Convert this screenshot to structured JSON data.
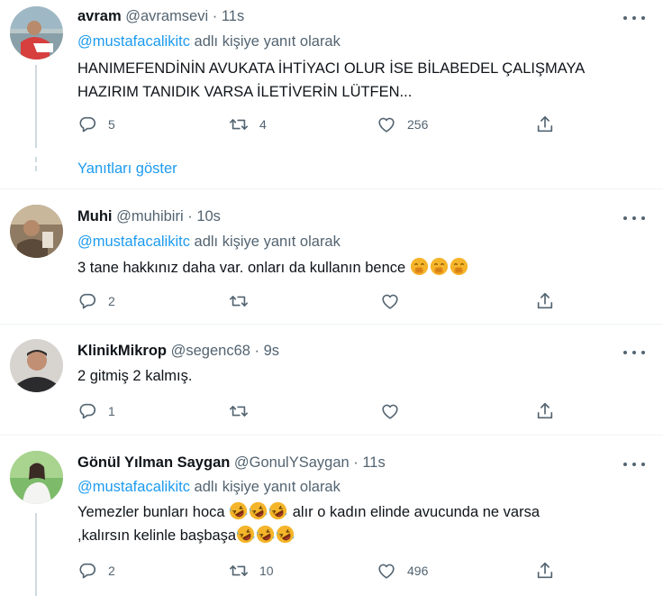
{
  "tweets": [
    {
      "name": "avram",
      "handle": "@avramsevi",
      "time": "11s",
      "reply_prefix": "",
      "mention": "@mustafacalikitc",
      "reply_suffix": " adlı kişiye yanıt olarak",
      "text_line1": "HANIMEFENDİNİN AVUKATA İHTİYACI OLUR İSE BİLABEDEL ÇALIŞMAYA",
      "text_line2": "HAZIRIM TANIDIK VARSA İLETİVERİN LÜTFEN...",
      "replies": "5",
      "retweets": "4",
      "likes": "256"
    },
    {
      "name": "Muhi",
      "handle": "@muhibiri",
      "time": "10s",
      "mention": "@mustafacalikitc",
      "reply_suffix": " adlı kişiye yanıt olarak",
      "text_line1": "3 tane hakkınız daha var. onları da kullanın bence ",
      "emoji": "face-with-hand-over-mouth",
      "replies": "2",
      "retweets": "",
      "likes": ""
    },
    {
      "name": "KlinikMikrop",
      "handle": "@segenc68",
      "time": "9s",
      "text_line1": "2 gitmiş 2 kalmış.",
      "replies": "1",
      "retweets": "",
      "likes": ""
    },
    {
      "name": "Gönül Yılman Saygan",
      "handle": "@GonulYSaygan",
      "time": "11s",
      "mention": "@mustafacalikitc",
      "reply_suffix": " adlı kişiye yanıt olarak",
      "text_line1a": "Yemezler bunları hoca ",
      "text_line1b": " alır o kadın elinde avucunda ne varsa",
      "text_line2": ",kalırsın kelinle başbaşa",
      "emoji": "rolling-on-the-floor-laughing",
      "replies": "2",
      "retweets": "10",
      "likes": "496"
    }
  ],
  "show_replies_label": "Yanıtları göster",
  "dot_separator": "·",
  "colors": {
    "accent": "#1d9bf0",
    "secondary_text": "#536471",
    "divider": "#eff3f4",
    "thread_line": "#cfd9de"
  }
}
